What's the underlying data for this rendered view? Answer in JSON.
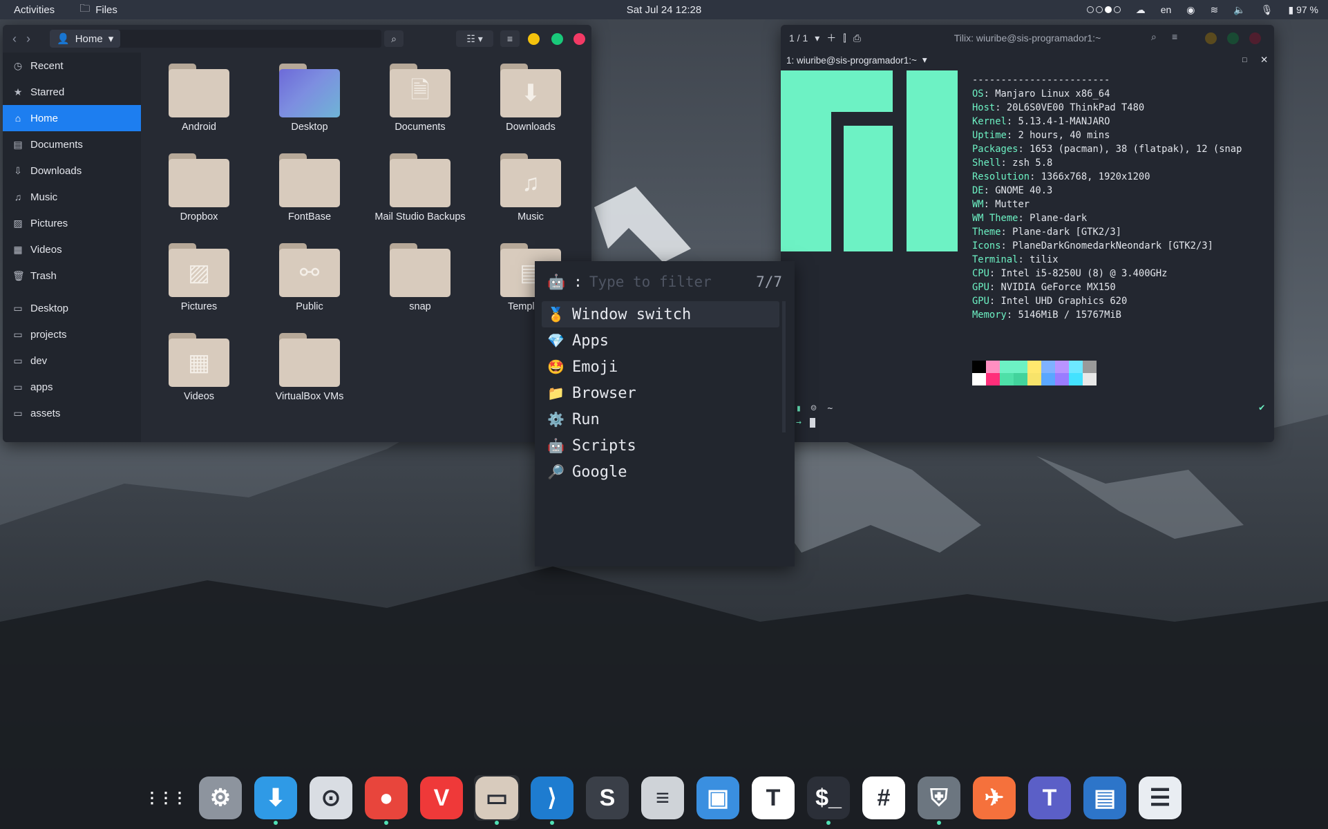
{
  "topbar": {
    "activities": "Activities",
    "app_name": "Files",
    "clock": "Sat Jul 24  12:28",
    "language": "en",
    "battery": "97 %"
  },
  "files": {
    "location": "Home",
    "sidebar": [
      {
        "label": "Recent",
        "icon": "clock-icon"
      },
      {
        "label": "Starred",
        "icon": "star-icon"
      },
      {
        "label": "Home",
        "icon": "home-icon",
        "active": true
      },
      {
        "label": "Documents",
        "icon": "document-icon"
      },
      {
        "label": "Downloads",
        "icon": "download-icon"
      },
      {
        "label": "Music",
        "icon": "music-icon"
      },
      {
        "label": "Pictures",
        "icon": "picture-icon"
      },
      {
        "label": "Videos",
        "icon": "video-icon"
      },
      {
        "label": "Trash",
        "icon": "trash-icon"
      },
      {
        "label": "Desktop",
        "icon": "folder-icon"
      },
      {
        "label": "projects",
        "icon": "folder-icon"
      },
      {
        "label": "dev",
        "icon": "folder-icon"
      },
      {
        "label": "apps",
        "icon": "folder-icon"
      },
      {
        "label": "assets",
        "icon": "folder-icon"
      }
    ],
    "folders": [
      "Android",
      "Desktop",
      "Documents",
      "Downloads",
      "Dropbox",
      "FontBase",
      "Mail Studio Backups",
      "Music",
      "Pictures",
      "Public",
      "snap",
      "Templates",
      "Videos",
      "VirtualBox VMs"
    ]
  },
  "terminal": {
    "tab_count": "1 / 1",
    "title": "Tilix: wiuribe@sis-programador1:~",
    "session": "1: wiuribe@sis-programador1:~",
    "separator": "------------------------",
    "info": [
      {
        "key": "OS",
        "value": "Manjaro Linux x86_64"
      },
      {
        "key": "Host",
        "value": "20L6S0VE00 ThinkPad T480"
      },
      {
        "key": "Kernel",
        "value": "5.13.4-1-MANJARO"
      },
      {
        "key": "Uptime",
        "value": "2 hours, 40 mins"
      },
      {
        "key": "Packages",
        "value": "1653 (pacman), 38 (flatpak), 12 (snap"
      },
      {
        "key": "Shell",
        "value": "zsh 5.8"
      },
      {
        "key": "Resolution",
        "value": "1366x768, 1920x1200"
      },
      {
        "key": "DE",
        "value": "GNOME 40.3"
      },
      {
        "key": "WM",
        "value": "Mutter"
      },
      {
        "key": "WM Theme",
        "value": "Plane-dark"
      },
      {
        "key": "Theme",
        "value": "Plane-dark [GTK2/3]"
      },
      {
        "key": "Icons",
        "value": "PlaneDarkGnomedarkNeondark [GTK2/3]"
      },
      {
        "key": "Terminal",
        "value": "tilix"
      },
      {
        "key": "CPU",
        "value": "Intel i5-8250U (8) @ 3.400GHz"
      },
      {
        "key": "GPU",
        "value": "NVIDIA GeForce MX150"
      },
      {
        "key": "GPU",
        "value": "Intel UHD Graphics 620"
      },
      {
        "key": "Memory",
        "value": "5146MiB / 15767MiB"
      }
    ],
    "palette_top": [
      "#000000",
      "#ff8fc1",
      "#6df2c4",
      "#6df2c4",
      "#ffe86e",
      "#7fb2ff",
      "#b994ff",
      "#6de8ff",
      "#9a9a9a"
    ],
    "palette_bottom": [
      "#ffffff",
      "#ff2e7a",
      "#4ee0a8",
      "#42d39c",
      "#f7e36a",
      "#5aa7ff",
      "#9a7cff",
      "#43e2ff",
      "#e8e8e8"
    ],
    "prompt_dir": "~",
    "accent": "#6df2c4"
  },
  "rofi": {
    "prompt": ":",
    "placeholder": "Type to filter",
    "count": "7/7",
    "items": [
      {
        "emoji": "🏅",
        "label": "Window switch",
        "selected": true
      },
      {
        "emoji": "💎",
        "label": "Apps"
      },
      {
        "emoji": "🤩",
        "label": "Emoji"
      },
      {
        "emoji": "📁",
        "label": "Browser"
      },
      {
        "emoji": "⚙️",
        "label": "Run"
      },
      {
        "emoji": "🤖",
        "label": "Scripts"
      },
      {
        "emoji": "🔎",
        "label": "Google"
      }
    ]
  },
  "dock": [
    {
      "name": "show-apps",
      "glyph": "⋮⋮⋮",
      "bg": "transparent"
    },
    {
      "name": "settings",
      "glyph": "⚙",
      "bg": "#8d949e"
    },
    {
      "name": "software-installer",
      "glyph": "⬇",
      "bg": "#2f9ae6",
      "running": true
    },
    {
      "name": "tweaks",
      "glyph": "⊙",
      "bg": "#d9dde3"
    },
    {
      "name": "chrome",
      "glyph": "●",
      "bg": "#e8453c",
      "running": true
    },
    {
      "name": "vivaldi",
      "glyph": "V",
      "bg": "#ef3939"
    },
    {
      "name": "files",
      "glyph": "▭",
      "bg": "#d8cbbd",
      "running": true,
      "active": true
    },
    {
      "name": "vscode",
      "glyph": "⟩",
      "bg": "#1e7cd0",
      "running": true
    },
    {
      "name": "s-app",
      "glyph": "S",
      "bg": "#3a3f48"
    },
    {
      "name": "text-editor",
      "glyph": "≡",
      "bg": "#cfd3d8"
    },
    {
      "name": "screenshot",
      "glyph": "▣",
      "bg": "#3a8fe0"
    },
    {
      "name": "typora",
      "glyph": "T",
      "bg": "#ffffff"
    },
    {
      "name": "terminal",
      "glyph": "$_",
      "bg": "#2b2f38",
      "running": true
    },
    {
      "name": "slack",
      "glyph": "#",
      "bg": "#ffffff"
    },
    {
      "name": "bitwarden",
      "glyph": "⛨",
      "bg": "#6c7680",
      "running": true
    },
    {
      "name": "postman",
      "glyph": "✈",
      "bg": "#f5713c"
    },
    {
      "name": "teams",
      "glyph": "T",
      "bg": "#5b5fc7"
    },
    {
      "name": "virtualbox",
      "glyph": "▤",
      "bg": "#2d75c9"
    },
    {
      "name": "forms",
      "glyph": "☰",
      "bg": "#e9edf2"
    }
  ]
}
